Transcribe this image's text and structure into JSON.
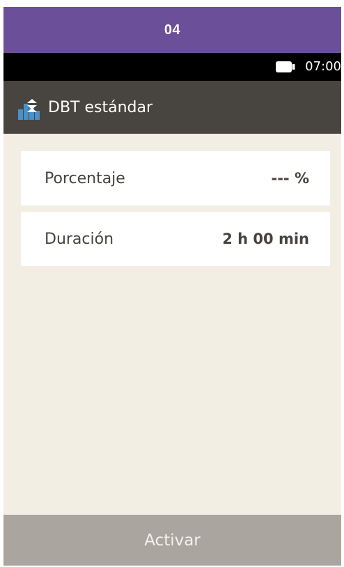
{
  "step_header": {
    "number": "04",
    "background_color": "#6c4f99"
  },
  "status_bar": {
    "battery_icon": "battery-full-icon",
    "time": "07:00"
  },
  "title_bar": {
    "icon": "basal-rate-icon",
    "title": "DBT estándar",
    "background_color": "#48443f"
  },
  "settings": {
    "rows": [
      {
        "label": "Porcentaje",
        "value": "--- %"
      },
      {
        "label": "Duración",
        "value": "2 h 00 min"
      }
    ]
  },
  "footer": {
    "action_label": "Activar",
    "background_color": "#aaa59e"
  }
}
